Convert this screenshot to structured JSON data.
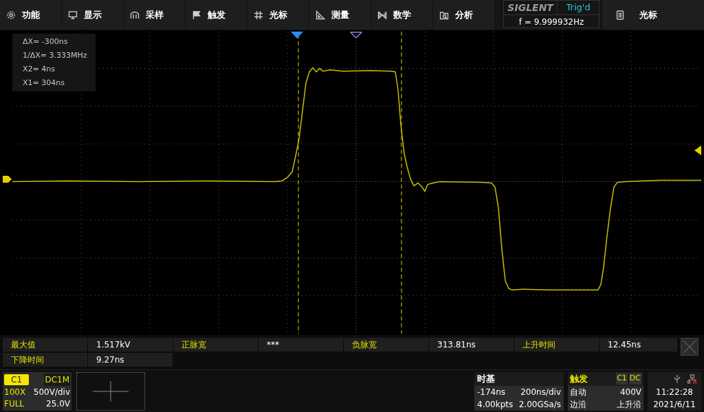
{
  "menu": [
    {
      "label": "功能"
    },
    {
      "label": "显示"
    },
    {
      "label": "采样"
    },
    {
      "label": "触发"
    },
    {
      "label": "光标"
    },
    {
      "label": "测量"
    },
    {
      "label": "数学"
    },
    {
      "label": "分析"
    }
  ],
  "brand": {
    "logo": "SIGLENT",
    "status": "Trig'd",
    "frequency": "f = 9.999932Hz"
  },
  "side_menu": {
    "label": "光标"
  },
  "cursor_readout": [
    "ΔX= -300ns",
    "1/ΔX= 3.333MHz",
    "X2= 4ns",
    "X1= 304ns"
  ],
  "measurements": [
    {
      "name": "最大值",
      "value": "1.517kV"
    },
    {
      "name": "正脉宽",
      "value": "***"
    },
    {
      "name": "负脉宽",
      "value": "313.81ns"
    },
    {
      "name": "上升时间",
      "value": "12.45ns"
    },
    {
      "name": "下降时间",
      "value": "9.27ns"
    }
  ],
  "channel": {
    "name": "C1",
    "coupling": "DC1M",
    "probe": "100X",
    "scale": "500V/div",
    "bandwidth": "FULL",
    "offset": "25.0V"
  },
  "timebase": {
    "title": "时基",
    "delay": "-174ns",
    "scale": "200ns/div",
    "memory": "4.00kpts",
    "sample_rate": "2.00GSa/s"
  },
  "trigger": {
    "title": "触发",
    "source": "C1",
    "coupling": "DC",
    "mode": "自动",
    "level": "400V",
    "type": "边沿",
    "slope": "上升沿"
  },
  "clock": {
    "time": "11:22:28",
    "date": "2021/6/11"
  }
}
